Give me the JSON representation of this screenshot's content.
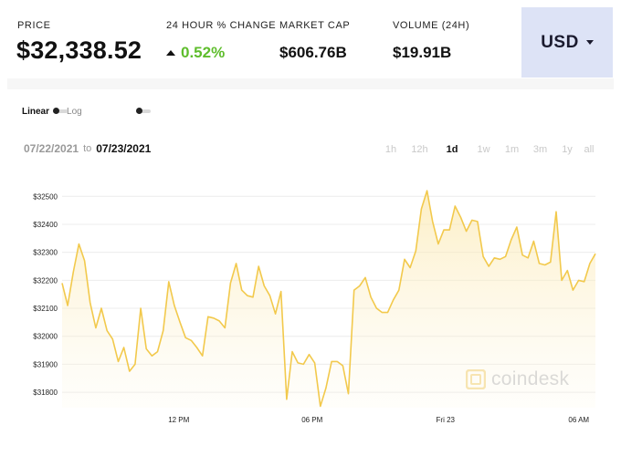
{
  "stats": {
    "price_label": "PRICE",
    "price_value": "$32,338.52",
    "change_label": "24 HOUR % CHANGE",
    "change_value": "0.52%",
    "mcap_label": "MARKET CAP",
    "mcap_value": "$606.76B",
    "volume_label": "VOLUME (24H)",
    "volume_value": "$19.91B"
  },
  "currency": {
    "label": "USD"
  },
  "scale": {
    "linear": "Linear",
    "log": "Log"
  },
  "date_range": {
    "from": "07/22/2021",
    "to_word": "to",
    "to": "07/23/2021"
  },
  "ranges": [
    {
      "label": "1h",
      "active": false
    },
    {
      "label": "12h",
      "active": false
    },
    {
      "label": "1d",
      "active": true
    },
    {
      "label": "1w",
      "active": false
    },
    {
      "label": "1m",
      "active": false
    },
    {
      "label": "3m",
      "active": false
    },
    {
      "label": "1y",
      "active": false
    },
    {
      "label": "all",
      "active": false
    }
  ],
  "watermark": "coindesk",
  "colors": {
    "line": "#f2c94c",
    "fill_top": "#fbe8b0",
    "change_up": "#5ebd2c",
    "currency_bg": "#dde3f6"
  },
  "chart_data": {
    "type": "area",
    "y_ticks": [
      "$31800",
      "$31900",
      "$32000",
      "$32100",
      "$32200",
      "$32300",
      "$32400",
      "$32500"
    ],
    "x_ticks": [
      "12 PM",
      "06 PM",
      "Fri 23",
      "06 AM"
    ],
    "ylim": [
      31745,
      32540
    ],
    "xlim": [
      0,
      96
    ],
    "x_tick_positions": [
      21,
      45,
      69,
      93
    ],
    "values": [
      32190,
      32110,
      32230,
      32330,
      32270,
      32120,
      32030,
      32100,
      32020,
      31990,
      31910,
      31960,
      31875,
      31900,
      32100,
      31955,
      31930,
      31945,
      32020,
      32195,
      32110,
      32050,
      31995,
      31985,
      31960,
      31930,
      32070,
      32065,
      32055,
      32030,
      32190,
      32260,
      32165,
      32145,
      32140,
      32250,
      32180,
      32145,
      32080,
      32160,
      31775,
      31945,
      31905,
      31900,
      31935,
      31905,
      31750,
      31815,
      31910,
      31910,
      31895,
      31795,
      32165,
      32180,
      32210,
      32140,
      32100,
      32085,
      32085,
      32130,
      32165,
      32275,
      32245,
      32305,
      32455,
      32520,
      32410,
      32330,
      32380,
      32380,
      32465,
      32425,
      32375,
      32415,
      32410,
      32285,
      32250,
      32280,
      32275,
      32285,
      32345,
      32390,
      32290,
      32280,
      32340,
      32260,
      32255,
      32265,
      32445,
      32200,
      32235,
      32165,
      32200,
      32195,
      32260,
      32295
    ],
    "grid": true,
    "legend": "none"
  }
}
